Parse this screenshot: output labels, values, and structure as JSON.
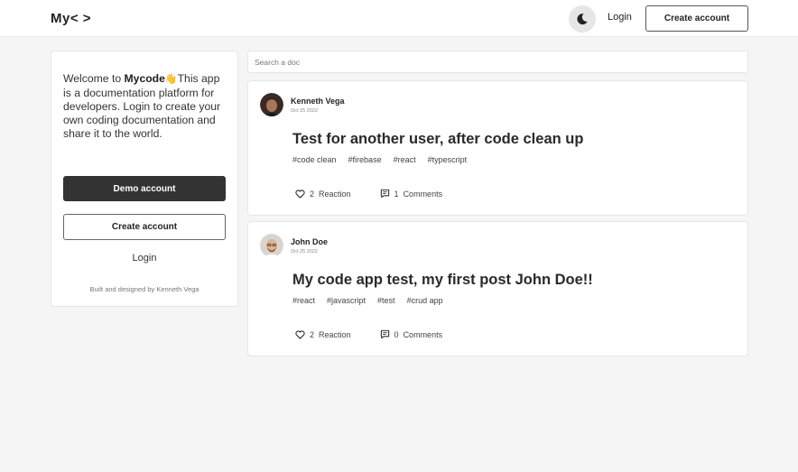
{
  "header": {
    "logo": "My< >",
    "theme_icon": "moon-icon",
    "login_label": "Login",
    "create_account_label": "Create account"
  },
  "sidebar": {
    "welcome_prefix": "Welcome to ",
    "brand": "Mycode",
    "wave_emoji": "👋",
    "welcome_suffix": "This app is a documentation platform for developers. Login to create your own coding documentation and share it to the world.",
    "demo_label": "Demo account",
    "create_label": "Create account",
    "login_label": "Login",
    "credit": "Built and designed by Kenneth Vega"
  },
  "search": {
    "placeholder": "Search a doc",
    "value": ""
  },
  "posts": [
    {
      "author": "Kenneth Vega",
      "date": "Oct 25 2022",
      "title": "Test for another user, after code clean up",
      "tags": [
        "#code clean",
        "#firebase",
        "#react",
        "#typescript"
      ],
      "reactions": "2",
      "reaction_label": "Reaction",
      "comments": "1",
      "comments_label": "Comments"
    },
    {
      "author": "John Doe",
      "date": "Oct 25 2022",
      "title": "My code app test, my first post John Doe!!",
      "tags": [
        "#react",
        "#javascript",
        "#test",
        "#crud app"
      ],
      "reactions": "2",
      "reaction_label": "Reaction",
      "comments": "0",
      "comments_label": "Comments"
    }
  ],
  "colors": {
    "background": "#f5f5f5",
    "card": "#ffffff",
    "primary_dark": "#333333",
    "border": "#e6e6e6"
  }
}
